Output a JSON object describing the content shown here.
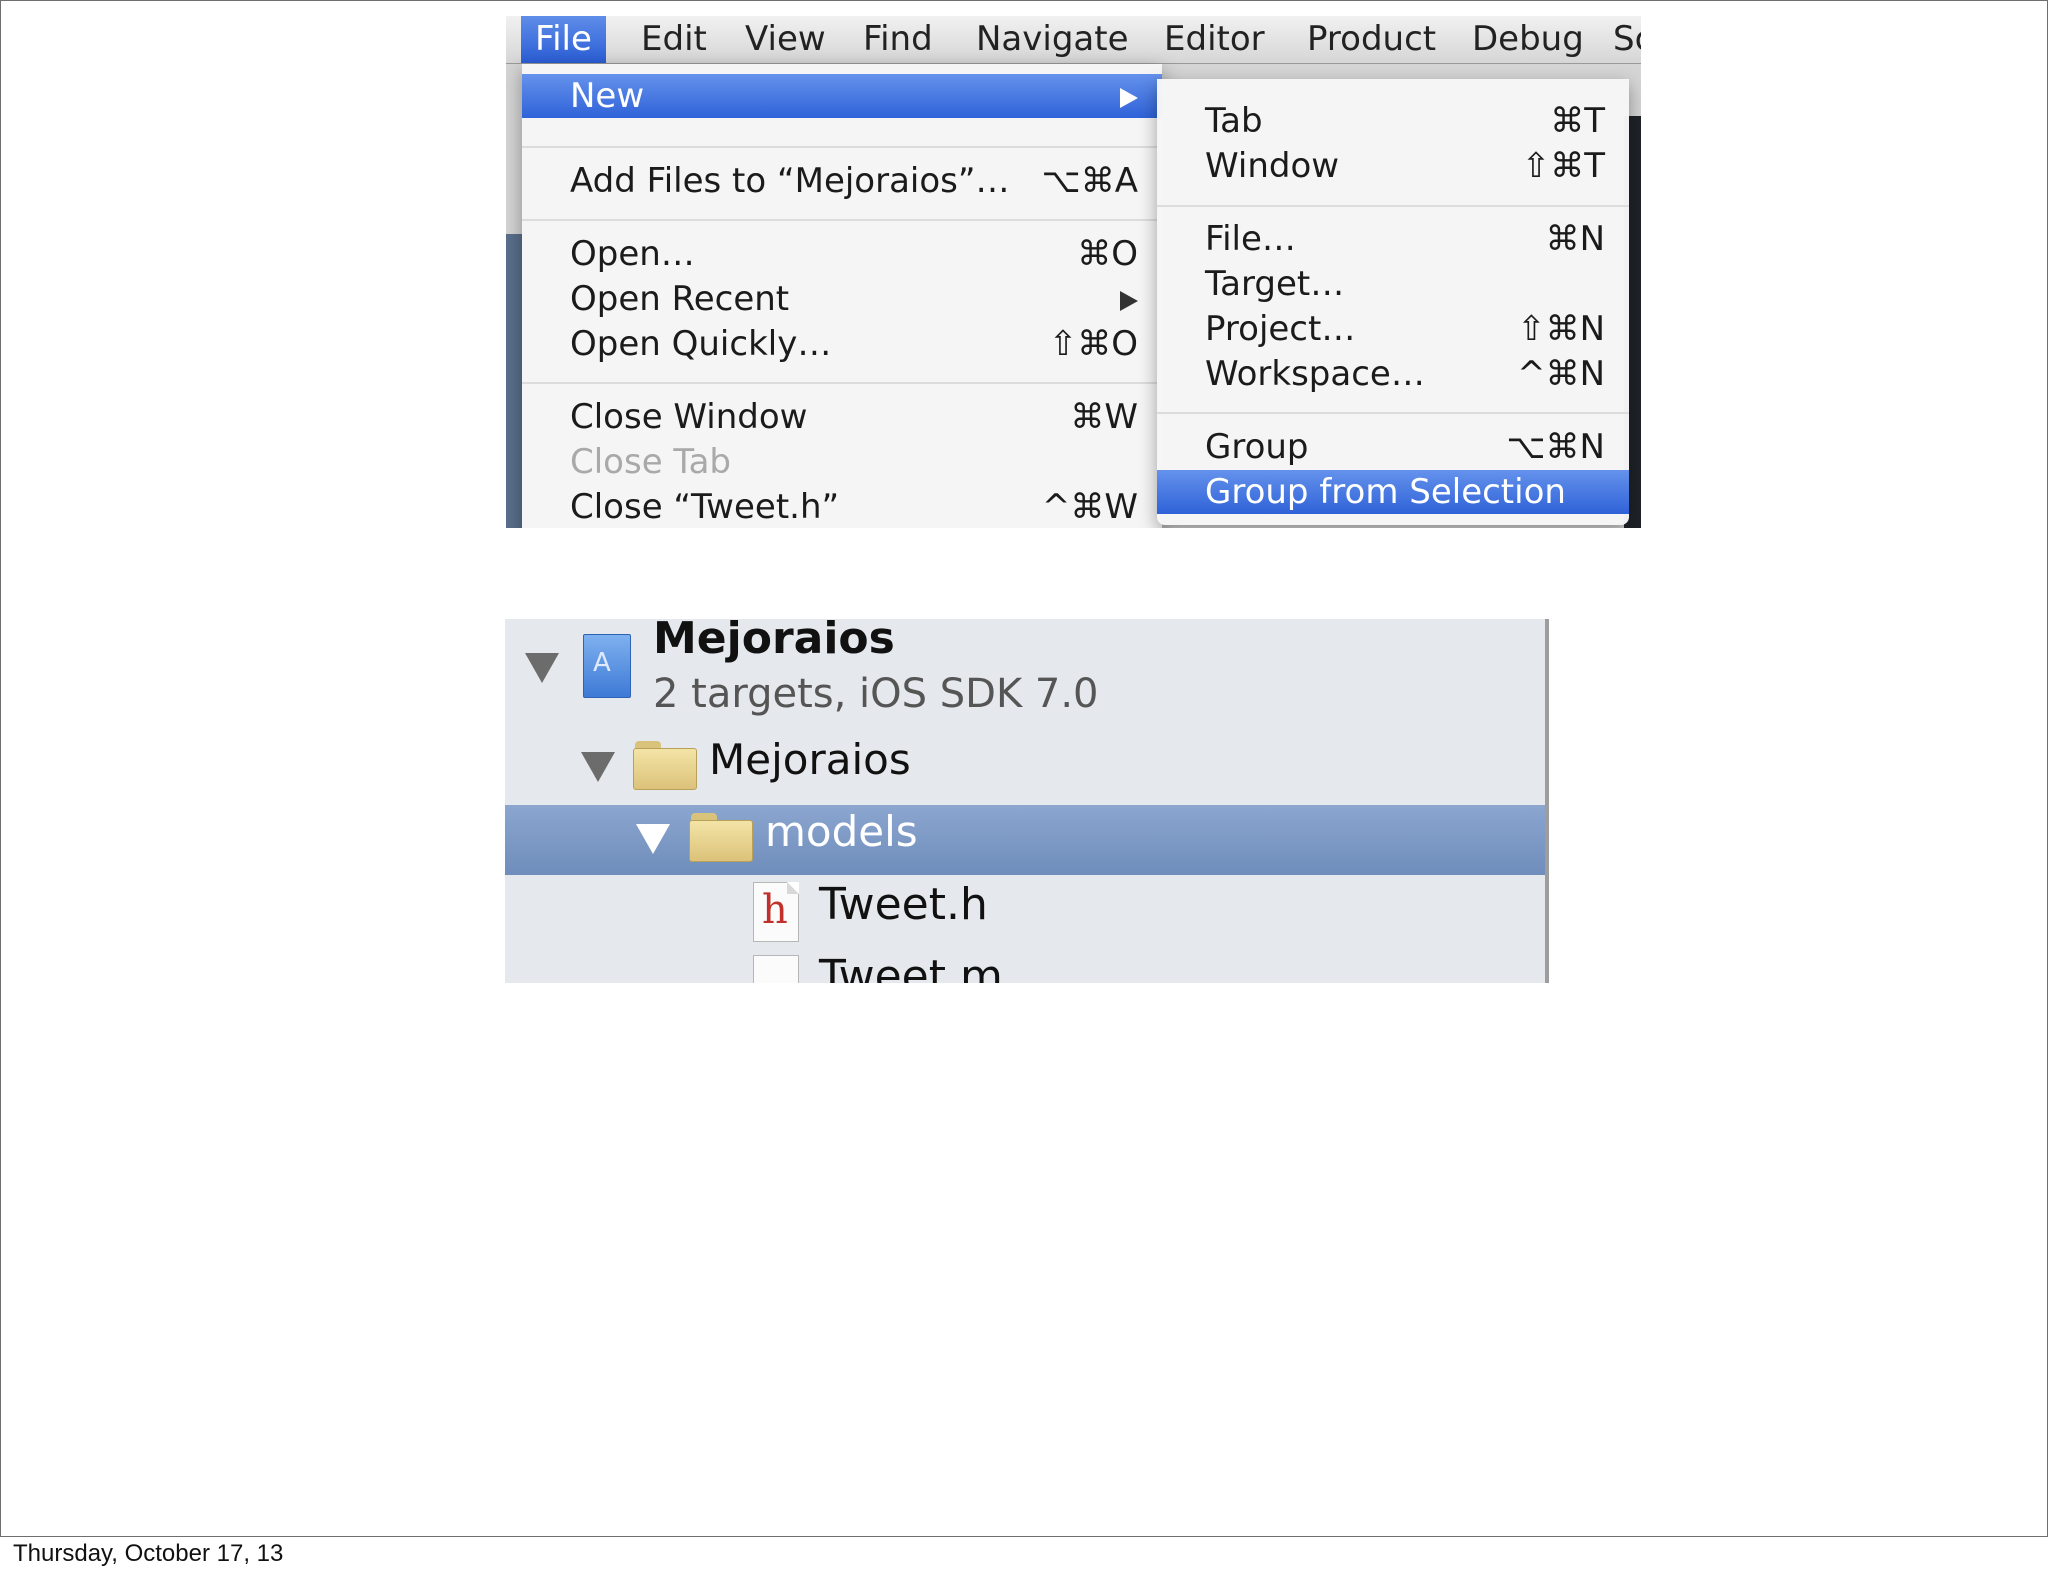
{
  "menubar": {
    "items": [
      "File",
      "Edit",
      "View",
      "Find",
      "Navigate",
      "Editor",
      "Product",
      "Debug",
      "Sc"
    ]
  },
  "file_menu": {
    "new": "New",
    "add_files": {
      "label": "Add Files to “Mejoraios”…",
      "shortcut": "⌥⌘A"
    },
    "open": {
      "label": "Open…",
      "shortcut": "⌘O"
    },
    "open_recent": "Open Recent",
    "open_quickly": {
      "label": "Open Quickly…",
      "shortcut": "⇧⌘O"
    },
    "close_window": {
      "label": "Close Window",
      "shortcut": "⌘W"
    },
    "close_tab": "Close Tab",
    "close_file": {
      "label": "Close “Tweet.h”",
      "shortcut": "^⌘W"
    }
  },
  "new_submenu": {
    "tab": {
      "label": "Tab",
      "shortcut": "⌘T"
    },
    "window": {
      "label": "Window",
      "shortcut": "⇧⌘T"
    },
    "file": {
      "label": "File…",
      "shortcut": "⌘N"
    },
    "target": {
      "label": "Target…"
    },
    "project": {
      "label": "Project…",
      "shortcut": "⇧⌘N"
    },
    "workspace": {
      "label": "Workspace…",
      "shortcut": "^⌘N"
    },
    "group": {
      "label": "Group",
      "shortcut": "⌥⌘N"
    },
    "group_from_selection": {
      "label": "Group from Selection"
    }
  },
  "navigator": {
    "project_name": "Mejoraios",
    "project_subtitle": "2 targets, iOS SDK 7.0",
    "group_name": "Mejoraios",
    "selected_group": "models",
    "file_h": "Tweet.h",
    "file_m": "Tweet.m"
  },
  "footer": {
    "date": "Thursday, October 17, 13"
  },
  "colors": {
    "highlight": "#2f62d8",
    "selection_row": "#7b97c4"
  }
}
